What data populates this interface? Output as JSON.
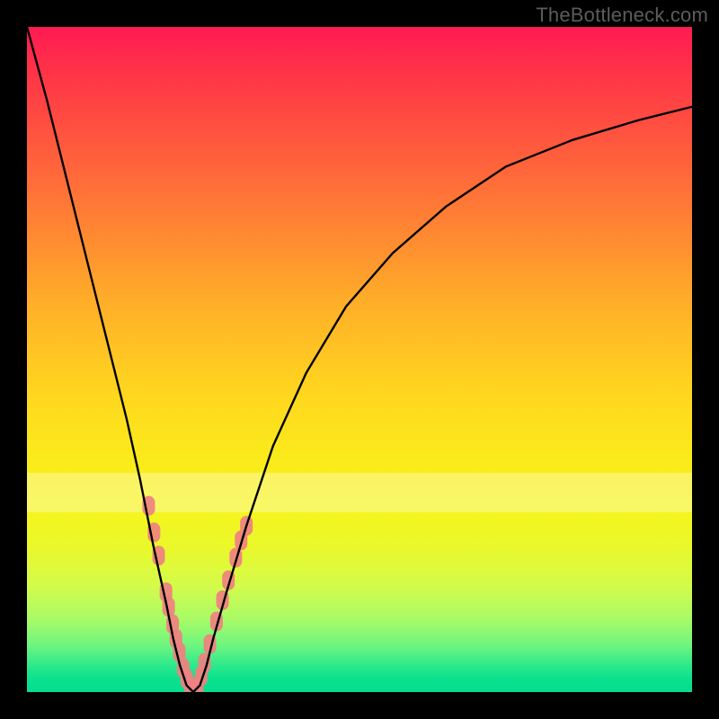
{
  "watermark": "TheBottleneck.com",
  "chart_data": {
    "type": "line",
    "title": "",
    "xlabel": "",
    "ylabel": "",
    "xlim": [
      0,
      100
    ],
    "ylim": [
      0,
      100
    ],
    "grid": false,
    "legend": false,
    "series": [
      {
        "name": "bottleneck-curve",
        "type": "line",
        "color": "#000000",
        "x": [
          0,
          3,
          6,
          9,
          12,
          15,
          17,
          19,
          21,
          22,
          23,
          24,
          25,
          26,
          27,
          28,
          30,
          33,
          37,
          42,
          48,
          55,
          63,
          72,
          82,
          92,
          100
        ],
        "y": [
          100,
          89,
          77,
          65,
          53,
          41,
          32,
          22,
          13,
          8,
          4,
          1,
          0,
          1,
          4,
          8,
          15,
          25,
          37,
          48,
          58,
          66,
          73,
          79,
          83,
          86,
          88
        ]
      },
      {
        "name": "highlight-points-left",
        "type": "scatter",
        "color": "#f08080",
        "x": [
          18.3,
          19.1,
          19.8,
          20.9,
          21.3,
          21.9,
          22.4,
          22.9,
          23.5,
          24.0,
          24.6
        ],
        "y": [
          28.0,
          24.0,
          20.5,
          15.0,
          12.8,
          10.2,
          8.0,
          6.0,
          3.6,
          2.0,
          0.8
        ]
      },
      {
        "name": "highlight-points-right",
        "type": "scatter",
        "color": "#f08080",
        "x": [
          25.6,
          26.2,
          26.7,
          27.5,
          28.5,
          29.4,
          30.3,
          31.4,
          32.2,
          33.0
        ],
        "y": [
          0.8,
          2.4,
          4.4,
          7.2,
          10.6,
          13.8,
          16.8,
          20.2,
          22.8,
          25.0
        ]
      }
    ]
  }
}
